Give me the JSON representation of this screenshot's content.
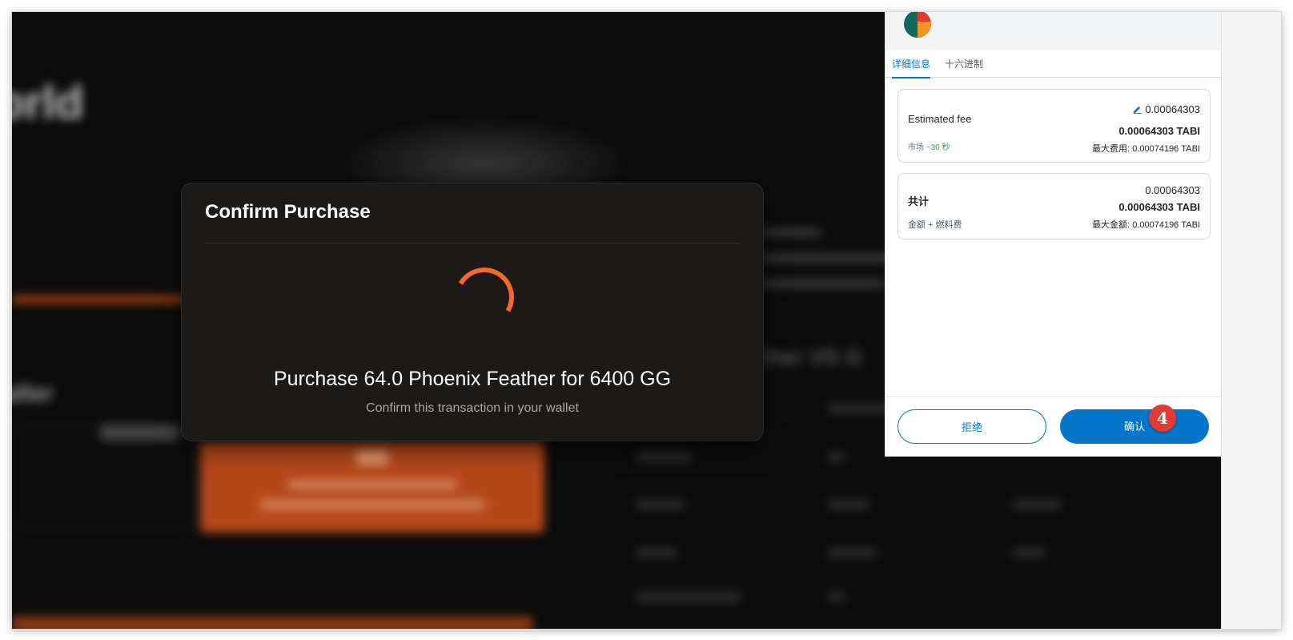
{
  "modal": {
    "title": "Confirm Purchase",
    "message": "Purchase 64.0 Phoenix Feather for 6400 GG",
    "subtitle": "Confirm this transaction in your wallet"
  },
  "wallet": {
    "tabs": [
      "详细信息",
      "十六进制"
    ],
    "fee_card": {
      "label": "Estimated fee",
      "amount": "0.00064303",
      "amount_token": "0.00064303 TABI",
      "speed_label": "市场",
      "speed_time": "~30 秒",
      "max_fee_label": "最大费用:",
      "max_fee_value": "0.00074196 TABI"
    },
    "total_card": {
      "label": "共计",
      "amount": "0.00064303",
      "amount_token": "0.00064303 TABI",
      "sub_label": "金额 + 燃料费",
      "max_amount_label": "最大金额:",
      "max_amount_value": "0.00074196 TABI"
    },
    "reject_label": "拒绝",
    "confirm_label": "确认"
  },
  "step_badge": "4",
  "colors": {
    "accent_orange": "#f2682d",
    "wallet_blue": "#0376c9",
    "badge_red": "#e53935"
  }
}
